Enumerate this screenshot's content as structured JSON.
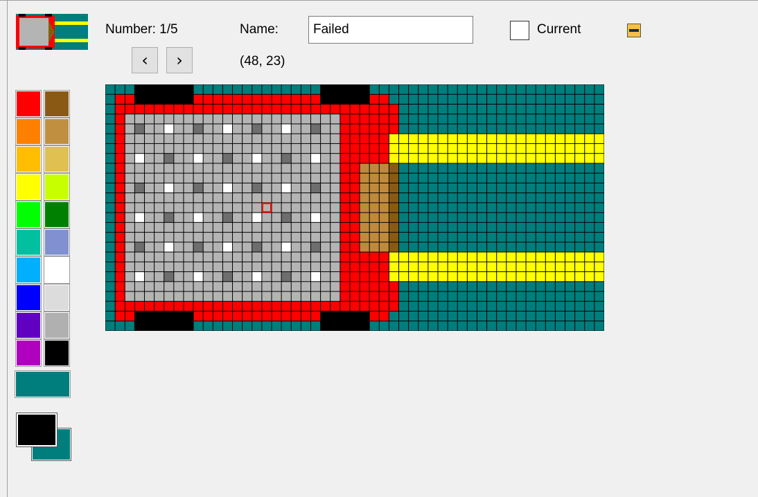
{
  "header": {
    "number_text": "Number: 1/5",
    "name_label": "Name:",
    "name_value": "Failed",
    "coordinates_text": "(48, 23)",
    "current_label": "Current",
    "current_checked": false
  },
  "nav": {
    "prev_glyph": "‹",
    "next_glyph": "›"
  },
  "palette": {
    "columns": [
      [
        "#ff0000",
        "#ff8000",
        "#ffbf00",
        "#ffff00",
        "#00ff00",
        "#00c0a0",
        "#00b0ff",
        "#0000ff",
        "#6000c0",
        "#b000c0"
      ],
      [
        "#8a5a14",
        "#c09040",
        "#dfc050",
        "#c8ff00",
        "#008000",
        "#8090d0",
        "#ffffff",
        "#dcdcdc",
        "#b0b0b0",
        "#000000"
      ]
    ],
    "wide_swatch": "#007e7e",
    "foreground": "#000000",
    "background": "#007e7e"
  },
  "icons": {
    "collapse": "minimize-icon",
    "prev": "chevron-left-icon",
    "next": "chevron-right-icon"
  },
  "colors": {
    "teal": "#007e7e",
    "red": "#ff0000",
    "gray": "#b4b4b4",
    "dark_gray": "#6e6e6e",
    "white": "#ffffff",
    "yellow": "#ffff00",
    "brown": "#c08a3c",
    "dark_brown": "#8a5a14",
    "black": "#000000"
  }
}
